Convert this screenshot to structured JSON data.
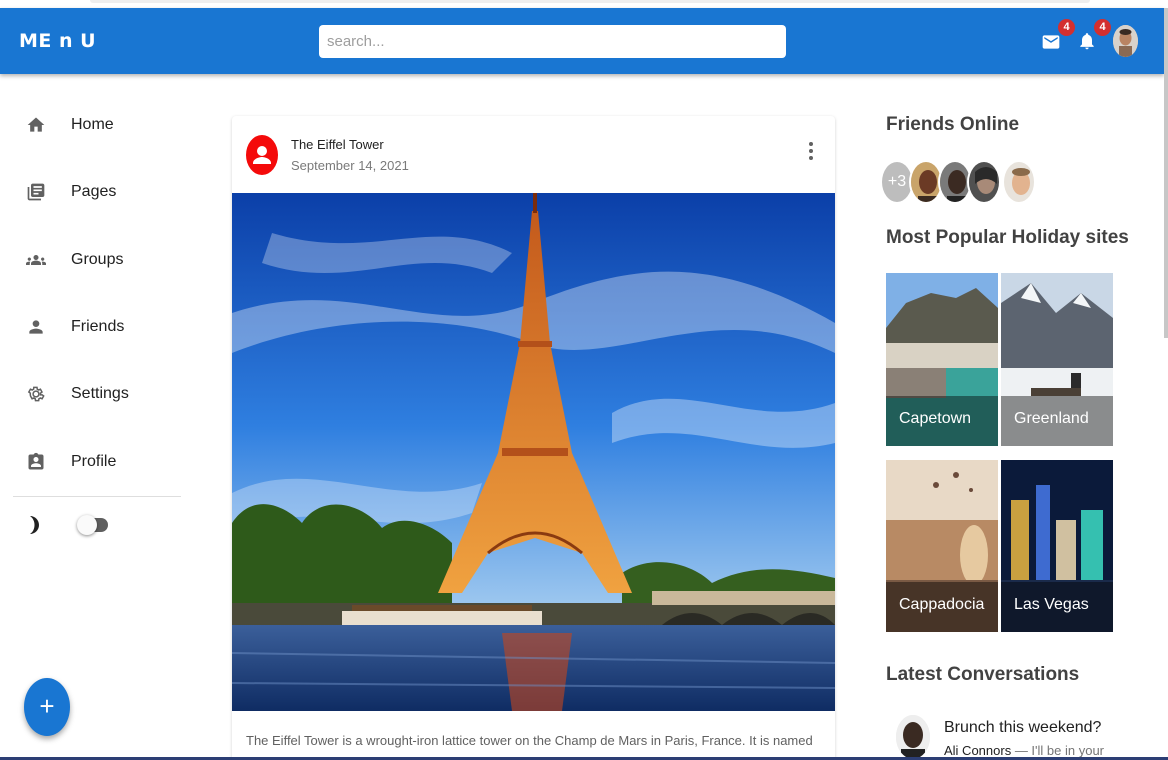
{
  "appbar": {
    "logo": "ME n U",
    "search_placeholder": "search...",
    "mail_badge": "4",
    "notifications_badge": "4",
    "color": "#1976d2"
  },
  "sidebar": {
    "items": [
      {
        "label": "Home",
        "icon": "home-icon"
      },
      {
        "label": "Pages",
        "icon": "pages-icon"
      },
      {
        "label": "Groups",
        "icon": "groups-icon"
      },
      {
        "label": "Friends",
        "icon": "person-icon"
      },
      {
        "label": "Settings",
        "icon": "gear-icon"
      },
      {
        "label": "Profile",
        "icon": "profile-badge-icon"
      }
    ],
    "dark_mode_toggle": "off"
  },
  "fab": {
    "label": "+"
  },
  "post": {
    "title": "The Eiffel Tower",
    "date": "September 14, 2021",
    "avatar_color": "#f40a0a",
    "body": "The Eiffel Tower is a wrought-iron lattice tower on the Champ de Mars in Paris, France. It is named after the engineer Gustave Eiffel, whose company designed and built the tower."
  },
  "right": {
    "friends_online_title": "Friends Online",
    "friends_more": "+3",
    "popular_title": "Most Popular Holiday sites",
    "sites": [
      {
        "name": "Capetown"
      },
      {
        "name": "Greenland"
      },
      {
        "name": "Cappadocia"
      },
      {
        "name": "Las Vegas"
      }
    ],
    "conversations_title": "Latest Conversations",
    "conversation": {
      "title": "Brunch this weekend?",
      "sender": "Ali Connors",
      "preview": " — I'll be in your"
    }
  }
}
